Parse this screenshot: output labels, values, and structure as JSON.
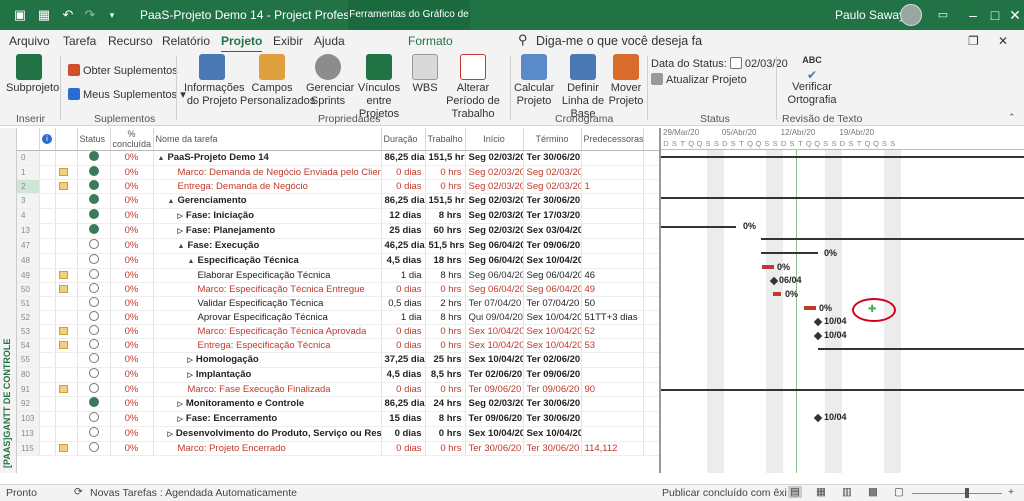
{
  "titlebar": {
    "title": "PaaS-Projeto Demo 14  -  Project Professional",
    "context_tab": "Ferramentas do Gráfico de Gantt",
    "user": "Paulo Sawaya"
  },
  "menu": {
    "items": [
      "Arquivo",
      "Tarefa",
      "Recurso",
      "Relatório",
      "Projeto",
      "Exibir",
      "Ajuda"
    ],
    "format": "Formato",
    "search": "Diga-me o que você deseja fa"
  },
  "ribbon": {
    "subprojeto": "Subprojeto",
    "inserir": "Inserir",
    "obter": "Obter Suplementos",
    "meus": "Meus Suplementos",
    "suplementos": "Suplementos",
    "info": "Informações do Projeto",
    "campos": "Campos Personalizados",
    "gerenciar": "Gerenciar Sprints",
    "vinculos": "Vínculos entre Projetos",
    "wbs": "WBS",
    "alterar": "Alterar Período de Trabalho",
    "propriedades": "Propriedades",
    "calcular": "Calcular Projeto",
    "definir": "Definir Linha de Base",
    "mover": "Mover Projeto",
    "cronograma": "Cronograma",
    "data_status_label": "Data do Status:",
    "data_status": "02/03/20",
    "atualizar": "Atualizar Projeto",
    "status": "Status",
    "verificar": "Verificar Ortografia",
    "abc": "ABC",
    "revisao": "Revisão de Texto"
  },
  "sidebar": "[PAAS]GANTT DE CONTROLE",
  "columns": [
    "Status",
    "% concluída",
    "Nome da tarefa",
    "Duração",
    "Trabalho",
    "Início",
    "Término",
    "Predecessoras"
  ],
  "rows": [
    {
      "id": "0",
      "st": "done",
      "pc": "0%",
      "name": "PaaS-Projeto Demo 14",
      "dur": "86,25 dias",
      "work": "151,5 hrs",
      "start": "Seg 02/03/20",
      "end": "Ter 30/06/20",
      "pred": "",
      "lvl": 0,
      "sum": true,
      "red": false,
      "note": false,
      "tri": "▲"
    },
    {
      "id": "1",
      "st": "done",
      "pc": "0%",
      "name": "Marco: Demanda de Negócio Enviada pelo Cliente",
      "dur": "0 dias",
      "work": "0 hrs",
      "start": "Seg 02/03/20",
      "end": "Seg 02/03/20",
      "pred": "",
      "lvl": 2,
      "sum": false,
      "red": true,
      "note": true,
      "tri": ""
    },
    {
      "id": "2",
      "st": "done",
      "pc": "0%",
      "name": "Entrega: Demanda de Negócio",
      "dur": "0 dias",
      "work": "0 hrs",
      "start": "Seg 02/03/20",
      "end": "Seg 02/03/20",
      "pred": "1",
      "lvl": 2,
      "sum": false,
      "red": true,
      "note": true,
      "tri": ""
    },
    {
      "id": "3",
      "st": "done",
      "pc": "0%",
      "name": "Gerenciamento",
      "dur": "86,25 dias",
      "work": "151,5 hrs",
      "start": "Seg 02/03/20",
      "end": "Ter 30/06/20",
      "pred": "",
      "lvl": 1,
      "sum": true,
      "red": false,
      "note": false,
      "tri": "▲"
    },
    {
      "id": "4",
      "st": "done",
      "pc": "0%",
      "name": "Fase: Iniciação",
      "dur": "12 dias",
      "work": "8 hrs",
      "start": "Seg 02/03/20",
      "end": "Ter 17/03/20",
      "pred": "",
      "lvl": 2,
      "sum": true,
      "red": false,
      "note": false,
      "tri": "▷"
    },
    {
      "id": "13",
      "st": "done",
      "pc": "0%",
      "name": "Fase: Planejamento",
      "dur": "25 dias",
      "work": "60 hrs",
      "start": "Seg 02/03/20",
      "end": "Sex 03/04/20",
      "pred": "",
      "lvl": 2,
      "sum": true,
      "red": false,
      "note": false,
      "tri": "▷"
    },
    {
      "id": "47",
      "st": "open",
      "pc": "0%",
      "name": "Fase: Execução",
      "dur": "46,25 dias",
      "work": "51,5 hrs",
      "start": "Seg 06/04/20",
      "end": "Ter 09/06/20",
      "pred": "",
      "lvl": 2,
      "sum": true,
      "red": false,
      "note": false,
      "tri": "▲"
    },
    {
      "id": "48",
      "st": "open",
      "pc": "0%",
      "name": "Especificação Técnica",
      "dur": "4,5 dias",
      "work": "18 hrs",
      "start": "Seg 06/04/20",
      "end": "Sex 10/04/20",
      "pred": "",
      "lvl": 3,
      "sum": true,
      "red": false,
      "note": false,
      "tri": "▲"
    },
    {
      "id": "49",
      "st": "open",
      "pc": "0%",
      "name": "Elaborar Especificação Técnica",
      "dur": "1 dia",
      "work": "8 hrs",
      "start": "Seg 06/04/20",
      "end": "Seg 06/04/20",
      "pred": "46",
      "lvl": 4,
      "sum": false,
      "red": false,
      "note": true,
      "tri": ""
    },
    {
      "id": "50",
      "st": "open",
      "pc": "0%",
      "name": "Marco: Especificação Técnica Entregue",
      "dur": "0 dias",
      "work": "0 hrs",
      "start": "Seg 06/04/20",
      "end": "Seg 06/04/20",
      "pred": "49",
      "lvl": 4,
      "sum": false,
      "red": true,
      "note": true,
      "tri": ""
    },
    {
      "id": "51",
      "st": "open",
      "pc": "0%",
      "name": "Validar Especificação Técnica",
      "dur": "0,5 dias",
      "work": "2 hrs",
      "start": "Ter 07/04/20",
      "end": "Ter 07/04/20",
      "pred": "50",
      "lvl": 4,
      "sum": false,
      "red": false,
      "note": false,
      "tri": ""
    },
    {
      "id": "52",
      "st": "open",
      "pc": "0%",
      "name": "Aprovar Especificação Técnica",
      "dur": "1 dia",
      "work": "8 hrs",
      "start": "Qui 09/04/20",
      "end": "Sex 10/04/20",
      "pred": "51TT+3 dias",
      "lvl": 4,
      "sum": false,
      "red": false,
      "note": false,
      "tri": ""
    },
    {
      "id": "53",
      "st": "open",
      "pc": "0%",
      "name": "Marco: Especificação Técnica Aprovada",
      "dur": "0 dias",
      "work": "0 hrs",
      "start": "Sex 10/04/20",
      "end": "Sex 10/04/20",
      "pred": "52",
      "lvl": 4,
      "sum": false,
      "red": true,
      "note": true,
      "tri": ""
    },
    {
      "id": "54",
      "st": "open",
      "pc": "0%",
      "name": "Entrega: Especificação Técnica",
      "dur": "0 dias",
      "work": "0 hrs",
      "start": "Sex 10/04/20",
      "end": "Sex 10/04/20",
      "pred": "53",
      "lvl": 4,
      "sum": false,
      "red": true,
      "note": true,
      "tri": ""
    },
    {
      "id": "55",
      "st": "open",
      "pc": "0%",
      "name": "Homologação",
      "dur": "37,25 dias",
      "work": "25 hrs",
      "start": "Sex 10/04/20",
      "end": "Ter 02/06/20",
      "pred": "",
      "lvl": 3,
      "sum": true,
      "red": false,
      "note": false,
      "tri": "▷"
    },
    {
      "id": "80",
      "st": "open",
      "pc": "0%",
      "name": "Implantação",
      "dur": "4,5 dias",
      "work": "8,5 hrs",
      "start": "Ter 02/06/20",
      "end": "Ter 09/06/20",
      "pred": "",
      "lvl": 3,
      "sum": true,
      "red": false,
      "note": false,
      "tri": "▷"
    },
    {
      "id": "91",
      "st": "open",
      "pc": "0%",
      "name": "Marco: Fase Execução Finalizada",
      "dur": "0 dias",
      "work": "0 hrs",
      "start": "Ter 09/06/20",
      "end": "Ter 09/06/20",
      "pred": "90",
      "lvl": 3,
      "sum": false,
      "red": true,
      "note": true,
      "tri": ""
    },
    {
      "id": "92",
      "st": "done",
      "pc": "0%",
      "name": "Monitoramento e Controle",
      "dur": "86,25 dias",
      "work": "24 hrs",
      "start": "Seg 02/03/20",
      "end": "Ter 30/06/20",
      "pred": "",
      "lvl": 2,
      "sum": true,
      "red": false,
      "note": false,
      "tri": "▷"
    },
    {
      "id": "103",
      "st": "open",
      "pc": "0%",
      "name": "Fase: Encerramento",
      "dur": "15 dias",
      "work": "8 hrs",
      "start": "Ter 09/06/20",
      "end": "Ter 30/06/20",
      "pred": "",
      "lvl": 2,
      "sum": true,
      "red": false,
      "note": false,
      "tri": "▷"
    },
    {
      "id": "113",
      "st": "open",
      "pc": "0%",
      "name": "Desenvolvimento do Produto, Serviço ou Resultado",
      "dur": "0 dias",
      "work": "0 hrs",
      "start": "Sex 10/04/20",
      "end": "Sex 10/04/20",
      "pred": "",
      "lvl": 1,
      "sum": true,
      "red": false,
      "note": false,
      "tri": "▷"
    },
    {
      "id": "115",
      "st": "open",
      "pc": "0%",
      "name": "Marco: Projeto Encerrado",
      "dur": "0 dias",
      "work": "0 hrs",
      "start": "Ter 30/06/20",
      "end": "Ter 30/06/20",
      "pred": "114,112",
      "lvl": 2,
      "sum": false,
      "red": true,
      "note": true,
      "tri": ""
    }
  ],
  "gantt": {
    "weeks": [
      "29/Mar/20",
      "05/Abr/20",
      "12/Abr/20",
      "19/Abr/20"
    ],
    "days": [
      "D",
      "S",
      "T",
      "Q",
      "Q",
      "S",
      "S"
    ],
    "labels": {
      "pct": "0%",
      "d1": "06/04",
      "d2": "10/04"
    }
  },
  "status": {
    "ready": "Pronto",
    "mode": "Novas Tarefas : Agendada Automaticamente",
    "publish": "Publicar concluído com êxi"
  }
}
